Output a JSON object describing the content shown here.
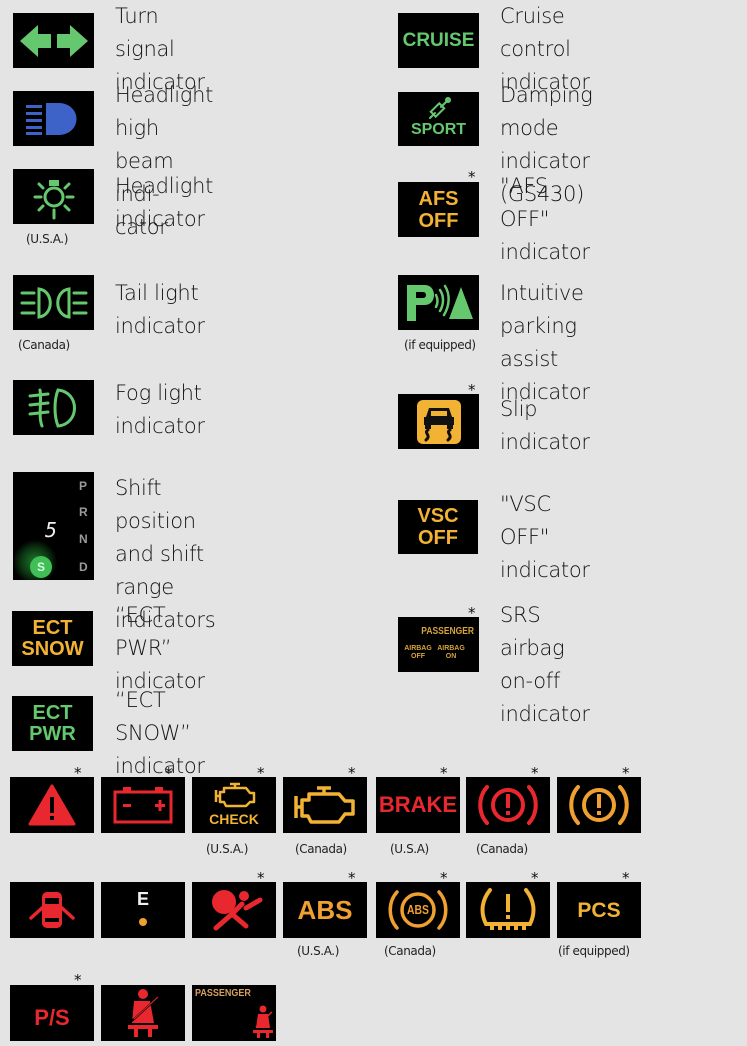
{
  "colors": {
    "background": "#e4e4e4",
    "green": "#66c86e",
    "blue": "#3e63c8",
    "amber": "#f2b233",
    "orange": "#f0a030",
    "red": "#e8282e",
    "white": "#f0f0f0"
  },
  "left_column": [
    {
      "icon": "turn-signal-icon",
      "label": "Turn signal indicator",
      "note": ""
    },
    {
      "icon": "headlight-high-beam-icon",
      "label": "Headlight high beam indi-\ncator",
      "note": ""
    },
    {
      "icon": "headlight-icon",
      "label": "Headlight indicator",
      "note": "(U.S.A.)"
    },
    {
      "icon": "tail-light-icon",
      "label": "Tail light indicator",
      "note": "(Canada)"
    },
    {
      "icon": "fog-light-icon",
      "label": "Fog light indicator",
      "note": ""
    },
    {
      "icon": "shift-position-icon",
      "label": "Shift position and shift\nrange indicators",
      "note": "",
      "gear_letters": [
        "P",
        "R",
        "N",
        "D"
      ],
      "gear_display": "5",
      "active_mode": "S"
    },
    {
      "icon": "ect-snow-icon",
      "label": "“ECT PWR” indicator",
      "note": "",
      "icon_text": [
        "ECT",
        "SNOW"
      ]
    },
    {
      "icon": "ect-pwr-icon",
      "label": "“ECT SNOW” indicator",
      "note": "",
      "icon_text": [
        "ECT",
        "PWR"
      ]
    }
  ],
  "right_column": [
    {
      "icon": "cruise-icon",
      "label": "Cruise control indicator",
      "note": "",
      "icon_text": [
        "CRUISE"
      ],
      "star": false
    },
    {
      "icon": "damping-sport-icon",
      "label": "Damping mode indicator\n(GS430)",
      "note": "",
      "icon_text": [
        "SPORT"
      ],
      "star": false
    },
    {
      "icon": "afs-off-icon",
      "label": "\"AFS OFF\" indicator",
      "note": "",
      "icon_text": [
        "AFS",
        "OFF"
      ],
      "star": true
    },
    {
      "icon": "parking-assist-icon",
      "label": "Intuitive parking assist\nindicator",
      "note": "(if equipped)",
      "star": false
    },
    {
      "icon": "slip-icon",
      "label": "Slip indicator",
      "note": "",
      "star": true
    },
    {
      "icon": "vsc-off-icon",
      "label": "\"VSC OFF\" indicator",
      "note": "",
      "icon_text": [
        "VSC",
        "OFF"
      ],
      "star": false
    },
    {
      "icon": "srs-airbag-on-off-icon",
      "label": "SRS airbag on-off\nindicator",
      "note": "",
      "icon_text": [
        "PASSENGER",
        "AIRBAG OFF",
        "AIRBAG ON"
      ],
      "star": true
    }
  ],
  "grid_rows": [
    [
      {
        "icon": "warning-triangle-icon",
        "note": "",
        "star": true
      },
      {
        "icon": "battery-icon",
        "note": "",
        "star": true
      },
      {
        "icon": "check-engine-icon",
        "note": "(U.S.A.)",
        "star": true,
        "icon_text": "CHECK"
      },
      {
        "icon": "engine-icon",
        "note": "(Canada)",
        "star": true
      },
      {
        "icon": "brake-text-icon",
        "note": "(U.S.A)",
        "star": true,
        "icon_text": "BRAKE"
      },
      {
        "icon": "brake-red-icon",
        "note": "(Canada)",
        "star": true
      },
      {
        "icon": "brake-amber-icon",
        "note": "",
        "star": true
      }
    ],
    [
      {
        "icon": "door-open-icon",
        "note": "",
        "star": false
      },
      {
        "icon": "low-fuel-icon",
        "note": "",
        "star": false,
        "icon_text": "E"
      },
      {
        "icon": "airbag-icon",
        "note": "",
        "star": true
      },
      {
        "icon": "abs-text-icon",
        "note": "(U.S.A.)",
        "star": true,
        "icon_text": "ABS"
      },
      {
        "icon": "abs-circle-icon",
        "note": "(Canada)",
        "star": true,
        "icon_text": "ABS"
      },
      {
        "icon": "tire-pressure-icon",
        "note": "",
        "star": true
      },
      {
        "icon": "pcs-icon",
        "note": "(if equipped)",
        "star": true,
        "icon_text": "PCS"
      }
    ],
    [
      {
        "icon": "power-steering-icon",
        "note": "",
        "star": true,
        "icon_text": "P/S"
      },
      {
        "icon": "seatbelt-icon",
        "note": "",
        "star": false
      },
      {
        "icon": "passenger-seatbelt-icon",
        "note": "",
        "star": false,
        "icon_text": "PASSENGER"
      }
    ]
  ],
  "star_symbol": "*"
}
